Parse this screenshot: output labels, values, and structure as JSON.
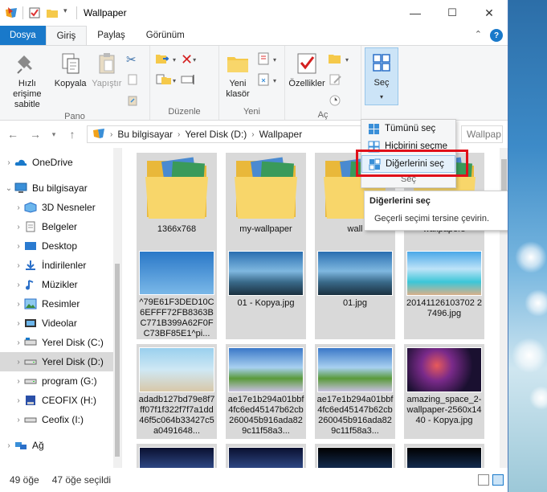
{
  "window": {
    "title": "Wallpaper",
    "minimize": "—",
    "maximize": "☐",
    "close": "✕"
  },
  "tabs": [
    "Dosya",
    "Giriş",
    "Paylaş",
    "Görünüm"
  ],
  "ribbon": {
    "pano": {
      "label": "Pano",
      "pin": "Hızlı erişime sabitle",
      "copy": "Kopyala",
      "paste": "Yapıştır"
    },
    "duzenle": {
      "label": "Düzenle"
    },
    "yeni": {
      "label": "Yeni",
      "new_folder": "Yeni klasör"
    },
    "ac": {
      "label": "Aç",
      "properties": "Özellikler"
    },
    "sec": {
      "label": "Seç",
      "button": "Seç"
    }
  },
  "address": {
    "crumbs": [
      "Bu bilgisayar",
      "Yerel Disk (D:)",
      "Wallpaper"
    ],
    "search_placeholder": "Wallpap"
  },
  "nav": {
    "items": [
      {
        "label": "OneDrive",
        "indent": 0
      },
      {
        "label": "Bu bilgisayar",
        "indent": 0,
        "expanded": true
      },
      {
        "label": "3D Nesneler",
        "indent": 1
      },
      {
        "label": "Belgeler",
        "indent": 1
      },
      {
        "label": "Desktop",
        "indent": 1
      },
      {
        "label": "İndirilenler",
        "indent": 1
      },
      {
        "label": "Müzikler",
        "indent": 1
      },
      {
        "label": "Resimler",
        "indent": 1
      },
      {
        "label": "Videolar",
        "indent": 1
      },
      {
        "label": "Yerel Disk (C:)",
        "indent": 1
      },
      {
        "label": "Yerel Disk (D:)",
        "indent": 1,
        "selected": true
      },
      {
        "label": "program (G:)",
        "indent": 1
      },
      {
        "label": "CEOFIX (H:)",
        "indent": 1
      },
      {
        "label": "Ceofix (I:)",
        "indent": 1
      },
      {
        "label": "Ağ",
        "indent": 0
      }
    ]
  },
  "files": [
    {
      "label": "1366x768",
      "kind": "folder"
    },
    {
      "label": "my-wallpaper",
      "kind": "folder"
    },
    {
      "label": "wall",
      "kind": "folder"
    },
    {
      "label": "wallpapers",
      "kind": "folder"
    },
    {
      "label": "^79E61F3DED10C6EFFF72FB8363BC771B399A62F0FC73BF85E1^pi...",
      "kind": "dandelion"
    },
    {
      "label": "01 - Kopya.jpg",
      "kind": "sunrays"
    },
    {
      "label": "01.jpg",
      "kind": "sunrays"
    },
    {
      "label": "20141126103702 27496.jpg",
      "kind": "pool"
    },
    {
      "label": "adadb127bd79e8f7ff07f1f322f7f7a1dd46f5c064b33427c5a0491648...",
      "kind": "flamingo"
    },
    {
      "label": "ae17e1b294a01bbf4fc6ed45147b62cb260045b916ada829c11f58a3...",
      "kind": "field"
    },
    {
      "label": "ae17e1b294a01bbf4fc6ed45147b62cb260045b916ada829c11f58a3...",
      "kind": "field"
    },
    {
      "label": "amazing_space_2-wallpaper-2560x1440 - Kopya.jpg",
      "kind": "space"
    }
  ],
  "dropdown": {
    "select_all": "Tümünü seç",
    "select_none": "Hiçbirini seçme",
    "invert": "Diğerlerini seç",
    "group_label": "Seç"
  },
  "tooltip": {
    "title": "Diğerlerini seç",
    "text": "Geçerli seçimi tersine çevirin."
  },
  "status": {
    "count": "49 öğe",
    "selected": "47 öğe seçildi"
  },
  "colors": {
    "accent": "#1979ca",
    "selection": "#d9d9d9",
    "highlight": "#e0101a"
  }
}
